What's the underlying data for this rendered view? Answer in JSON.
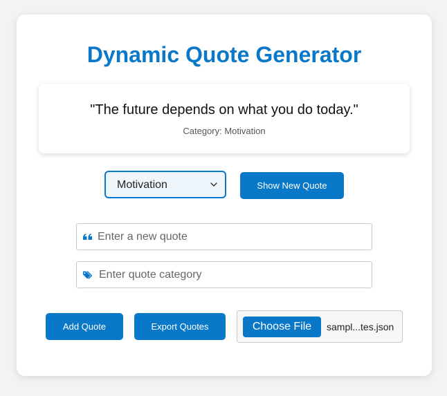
{
  "header": {
    "title": "Dynamic Quote Generator"
  },
  "quote": {
    "text": "\"The future depends on what you do today.\"",
    "category_line": "Category: Motivation"
  },
  "controls": {
    "category_select": {
      "selected": "Motivation"
    },
    "show_new_quote_label": "Show New Quote"
  },
  "form": {
    "quote_input": {
      "placeholder": "Enter a new quote",
      "icon": "quote-left-icon"
    },
    "category_input": {
      "placeholder": "Enter quote category",
      "icon": "tags-icon"
    }
  },
  "actions": {
    "add_quote_label": "Add Quote",
    "export_quotes_label": "Export Quotes",
    "choose_file_label": "Choose File",
    "file_name": "sampl...tes.json"
  },
  "colors": {
    "accent": "#0a78c8",
    "background": "#f3f3f3",
    "card": "#ffffff"
  }
}
